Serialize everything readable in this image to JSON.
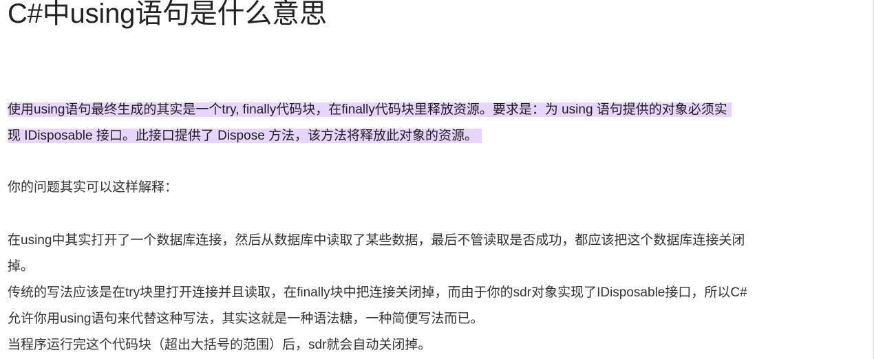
{
  "article": {
    "title": "C#中using语句是什么意思",
    "highlight_lines": [
      "使用using语句最终生成的其实是一个try, finally代码块，在finally代码块里释放资源。要求是：为 using 语句提供的对象必须实",
      "现 IDisposable 接口。此接口提供了 Dispose 方法，该方法将释放此对象的资源。"
    ],
    "intro": "你的问题其实可以这样解释：",
    "body_lines": [
      "在using中其实打开了一个数据库连接，然后从数据库中读取了某些数据，最后不管读取是否成功，都应该把这个数据库连接关闭",
      "掉。",
      "传统的写法应该是在try块里打开连接并且读取，在finally块中把连接关闭掉，而由于你的sdr对象实现了IDisposable接口，所以C#",
      "允许你用using语句来代替这种写法，其实这就是一种语法糖，一种简便写法而已。",
      "当程序运行完这个代码块（超出大括号的范围）后，sdr就会自动关闭掉。"
    ]
  }
}
